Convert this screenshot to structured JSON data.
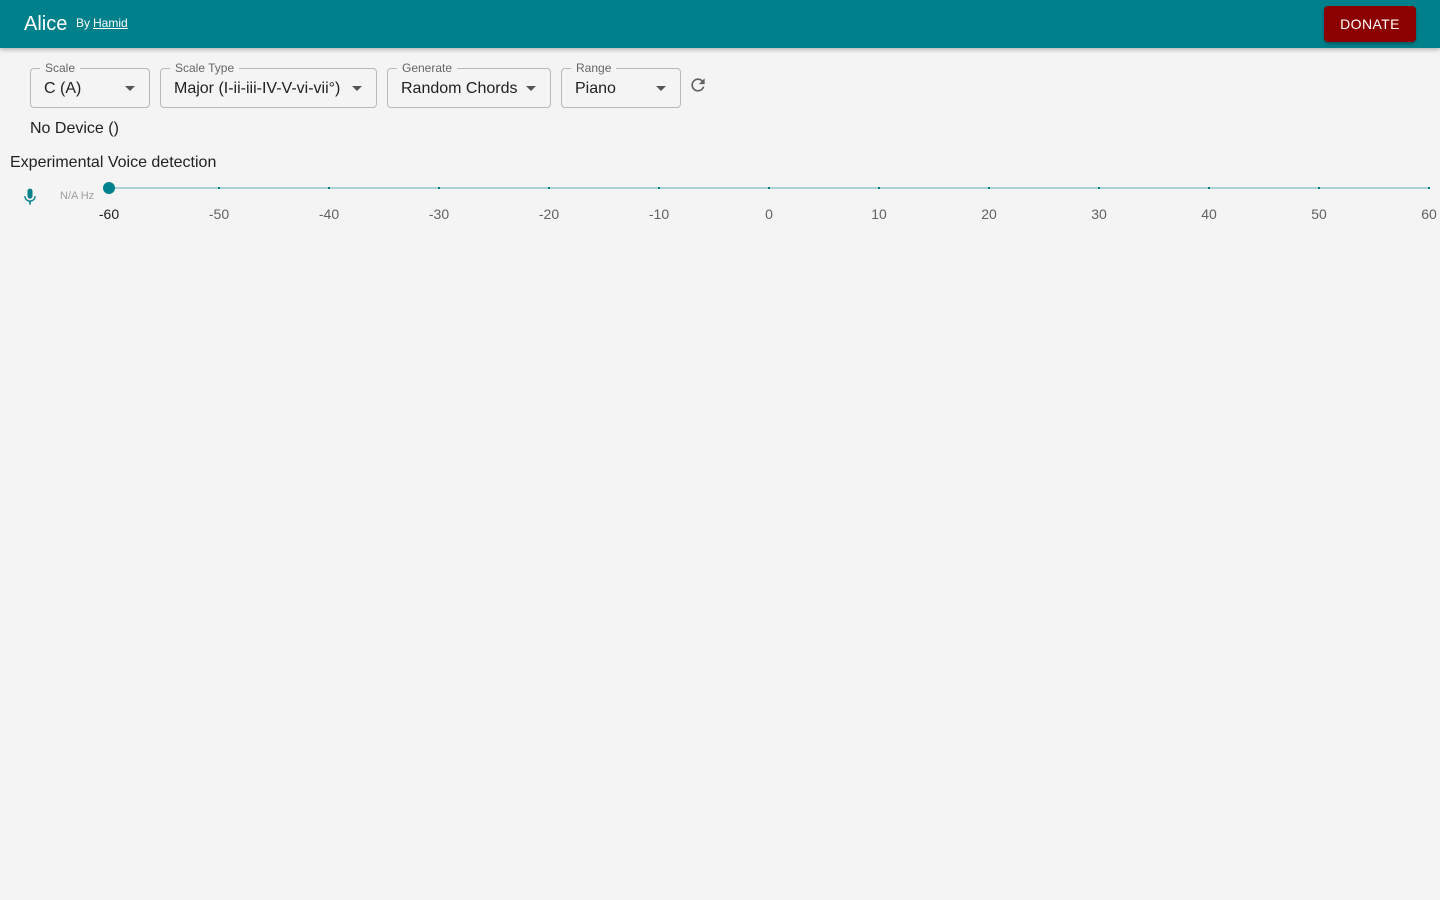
{
  "header": {
    "title": "Alice",
    "by": "By",
    "author": "Hamid",
    "donate_label": "DONATE"
  },
  "controls": {
    "scale": {
      "label": "Scale",
      "value": "C (A)"
    },
    "scale_type": {
      "label": "Scale Type",
      "value": "Major (I-ii-iii-IV-V-vi-vii°)"
    },
    "generate": {
      "label": "Generate",
      "value": "Random Chords"
    },
    "range": {
      "label": "Range",
      "value": "Piano"
    },
    "refresh_icon": "refresh-icon"
  },
  "device": {
    "text": "No Device ()"
  },
  "voice": {
    "title": "Experimental Voice detection",
    "mic_icon": "mic-icon",
    "frequency": "N/A Hz",
    "slider": {
      "min": -60,
      "max": 60,
      "value": -60,
      "marks": [
        "-60",
        "-50",
        "-40",
        "-30",
        "-20",
        "-10",
        "0",
        "10",
        "20",
        "30",
        "40",
        "50",
        "60"
      ]
    }
  },
  "colors": {
    "primary": "#00808a",
    "donate": "#8b0000",
    "background": "#f4f4f4"
  }
}
